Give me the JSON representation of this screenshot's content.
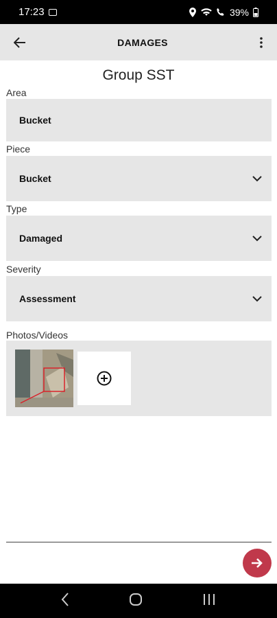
{
  "status_bar": {
    "time": "17:23",
    "battery": "39%"
  },
  "app_bar": {
    "title": "DAMAGES"
  },
  "group_title": "Group SST",
  "fields": {
    "area": {
      "label": "Area",
      "value": "Bucket"
    },
    "piece": {
      "label": "Piece",
      "value": "Bucket"
    },
    "type": {
      "label": "Type",
      "value": "Damaged"
    },
    "severity": {
      "label": "Severity",
      "value": "Assessment"
    }
  },
  "photos": {
    "label": "Photos/Videos"
  },
  "colors": {
    "accent": "#c0394b",
    "field_bg": "#e6e6e6",
    "appbar_bg": "#e6e6e6"
  }
}
